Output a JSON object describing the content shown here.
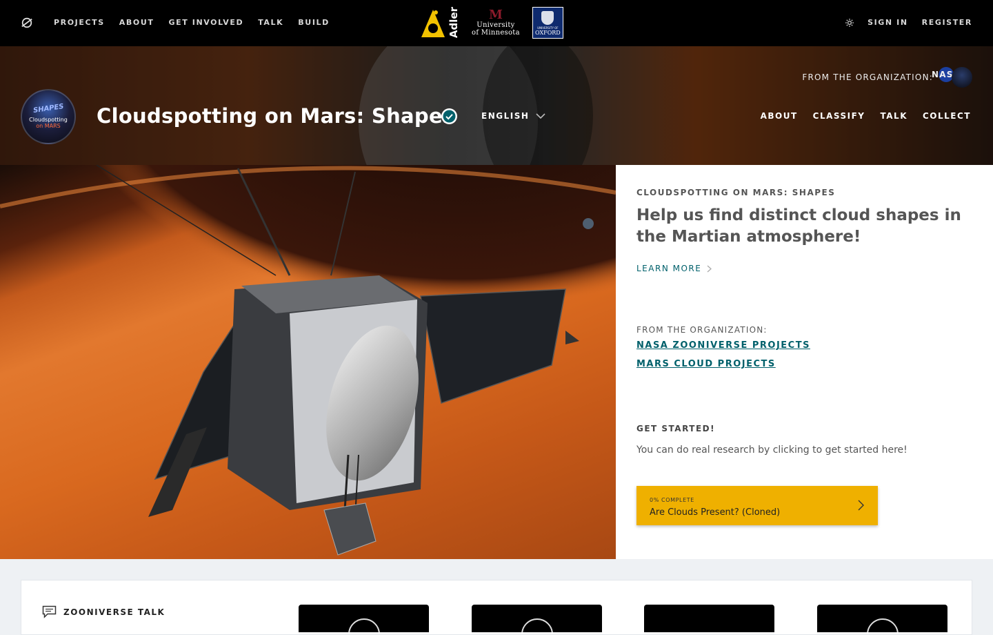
{
  "nav": {
    "links": [
      "PROJECTS",
      "ABOUT",
      "GET INVOLVED",
      "TALK",
      "BUILD"
    ],
    "partners": {
      "adler": "Adler",
      "umn_line1": "University",
      "umn_line2": "of Minnesota",
      "oxford_small": "UNIVERSITY OF",
      "oxford": "OXFORD"
    },
    "sign_in": "SIGN IN",
    "register": "REGISTER"
  },
  "project": {
    "title": "Cloudspotting on Mars: Shapes",
    "avatar_word": "SHAPES",
    "avatar_line1": "Cloudspotting",
    "avatar_line2": "on MARS",
    "language": "ENGLISH",
    "from_org_label": "FROM THE ORGANIZATION:",
    "org_logo_text": "NASA",
    "nav": [
      "ABOUT",
      "CLASSIFY",
      "TALK",
      "COLLECT"
    ]
  },
  "info": {
    "kicker": "CLOUDSPOTTING ON MARS: SHAPES",
    "description": "Help us find distinct cloud shapes in the Martian atmosphere!",
    "learn_more": "LEARN MORE",
    "org_label": "FROM THE ORGANIZATION:",
    "org_links": [
      "NASA ZOONIVERSE PROJECTS",
      "MARS CLOUD PROJECTS"
    ],
    "get_started_title": "GET STARTED!",
    "get_started_text": "You can do real research by clicking to get started here!",
    "workflow": {
      "progress_label": "0% COMPLETE",
      "progress": 0,
      "name": "Are Clouds Present? (Cloned)"
    }
  },
  "talk": {
    "title": "ZOONIVERSE TALK"
  },
  "colors": {
    "accent_teal": "#00606b",
    "workflow_yellow": "#efb000",
    "nav_bg": "#000000"
  }
}
